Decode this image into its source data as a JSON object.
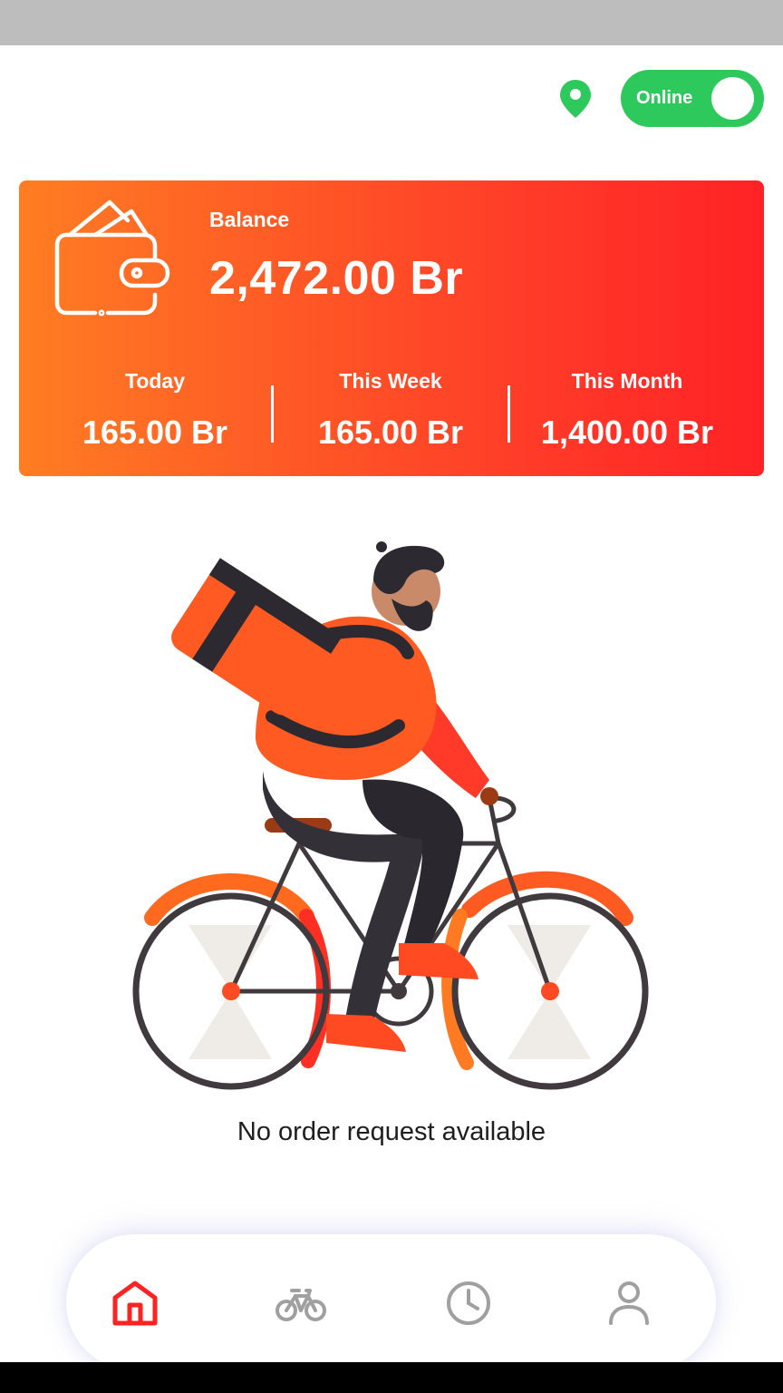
{
  "status": {
    "online_label": "Online",
    "online_enabled": true,
    "location_icon": "map-pin-icon"
  },
  "balance": {
    "label": "Balance",
    "amount": "2,472.00 Br",
    "icon": "wallet-icon"
  },
  "stats": [
    {
      "label": "Today",
      "value": "165.00 Br"
    },
    {
      "label": "This Week",
      "value": "165.00 Br"
    },
    {
      "label": "This Month",
      "value": "1,400.00 Br"
    }
  ],
  "empty_state": {
    "message": "No order request available",
    "illustration": "delivery-cyclist-illustration"
  },
  "bottom_nav": {
    "items": [
      {
        "icon": "home-icon",
        "active": true
      },
      {
        "icon": "bicycle-icon",
        "active": false
      },
      {
        "icon": "clock-icon",
        "active": false
      },
      {
        "icon": "user-icon",
        "active": false
      }
    ]
  },
  "colors": {
    "accent": "#ff3a28",
    "card_gradient_start": "#ff7d22",
    "card_gradient_end": "#ff2226",
    "online_green": "#2ec95c",
    "nav_active": "#ff2222",
    "nav_inactive": "#a0a0a0"
  }
}
